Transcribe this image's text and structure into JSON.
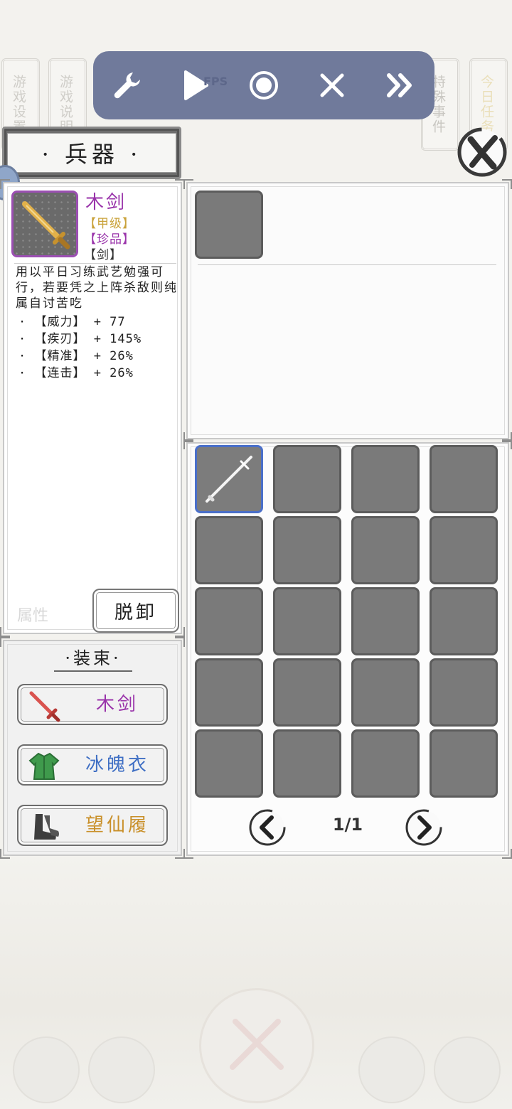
{
  "side_tabs": [
    {
      "label": "游戏设置"
    },
    {
      "label": "游戏说明"
    },
    {
      "label": "特殊事件"
    },
    {
      "label": "今日任务"
    }
  ],
  "toolbar": {
    "fps_text": "FPS"
  },
  "header": {
    "title": "· 兵器 ·"
  },
  "item": {
    "name": "木剑",
    "name_color": "#9933aa",
    "grade": "【甲级】",
    "grade_color": "#c9a23a",
    "rarity": "【珍品】",
    "rarity_color": "#9933aa",
    "type": "【剑】",
    "description": "用以平日习练武艺勉强可行，若要凭之上阵杀敌则纯属自讨苦吃",
    "stats": [
      {
        "label": "· 【威力】 + 77"
      },
      {
        "label": "· 【疾刃】 + 145%"
      },
      {
        "label": "· 【精准】 + 26%"
      },
      {
        "label": "· 【连击】 + 26%"
      }
    ],
    "unequip_label": "脱卸"
  },
  "ghost": {
    "attr_label": "属性"
  },
  "outfit": {
    "title": "·装束·",
    "items": [
      {
        "label": "木剑",
        "color": "#9933aa",
        "icon": "red-sword-icon"
      },
      {
        "label": "冰魄衣",
        "color": "#3f6fc4",
        "icon": "green-robe-icon"
      },
      {
        "label": "望仙履",
        "color": "#c9902a",
        "icon": "boots-icon"
      }
    ]
  },
  "inventory": {
    "page": "1/1",
    "selected_index": 0,
    "selected_item_icon": "white-staff-icon"
  }
}
